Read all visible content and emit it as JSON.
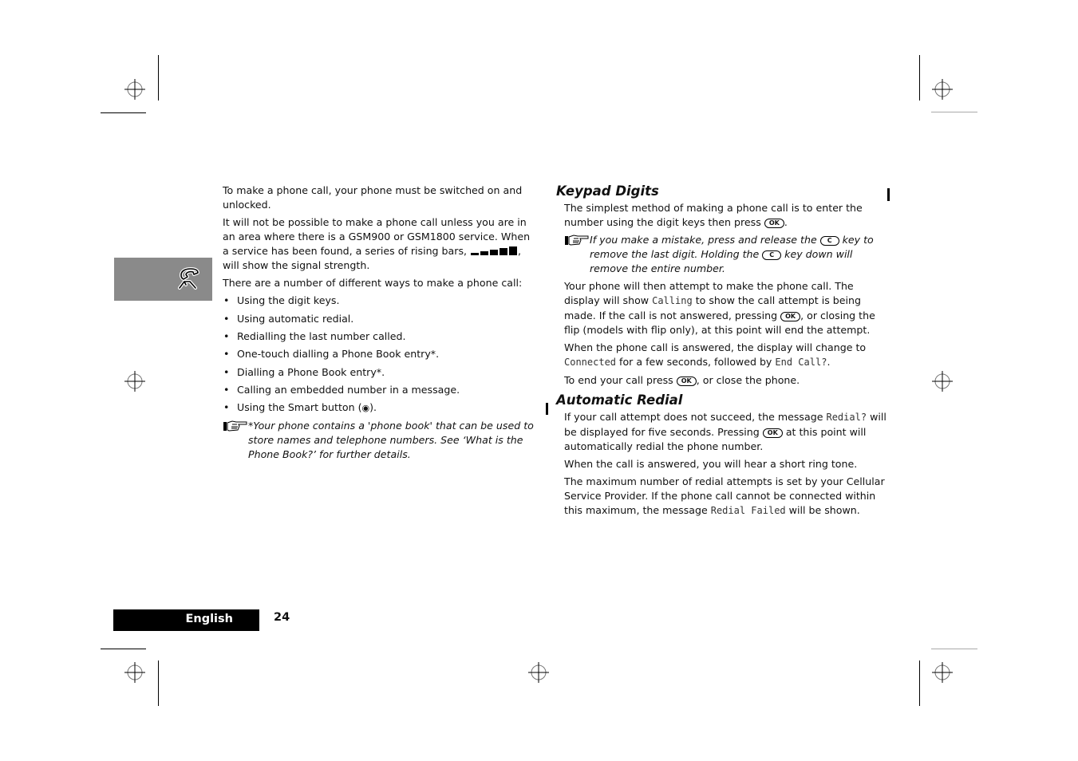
{
  "left_column": {
    "paragraphs": [
      "To make a phone call, your phone must be switched on and unlocked.",
      "It will not be possible to make a phone call unless you are in an area where there is a GSM900 or GSM1800 service. When a service has been found, a series of rising bars,",
      ", will show the signal strength.",
      "There are a number of different ways to make a phone call:"
    ],
    "bullets": [
      "Using the digit keys.",
      "Using automatic redial.",
      "Redialling the last number called.",
      "One-touch dialling a Phone Book entry*.",
      "Dialling a Phone Book entry*.",
      "Calling an embedded number in a message.",
      "Using the Smart button ("
    ],
    "bullet_tail": ").",
    "bullet_char": "•",
    "smart_icon": "◉",
    "note": "*Your phone contains a 'phone book' that can be used to store names and telephone numbers. See ‘What is the Phone Book?’ for further details."
  },
  "right_column": {
    "keypad": {
      "heading": "Keypad Digits",
      "p1a": "The simplest method of making a phone call is to enter the number using the digit keys then press",
      "p1b": ".",
      "note_a": "If you make a mistake, press and release the",
      "note_b": "key to remove the last digit. Holding the",
      "note_c": "key down will remove the entire number.",
      "p2a": "Your phone will then attempt to make the phone call. The display will show",
      "p2_mono": "Calling",
      "p2b": "to show the call attempt is being made. If the call is not answered, pressing",
      "p2c": ", or closing the flip (models with flip only), at this point will end the attempt.",
      "p3a": "When the phone call is answered, the display will change to",
      "p3_mono1": "Connected",
      "p3b": "for a few seconds, followed by",
      "p3_mono2": "End Call?",
      "p3c": ".",
      "p4a": "To end your call press",
      "p4b": ", or close the phone."
    },
    "redial": {
      "heading": "Automatic Redial",
      "p1a": "If your call attempt does not succeed, the message",
      "p1_mono": "Redial?",
      "p1b": "will be displayed for five seconds. Pressing",
      "p1c": "at this point will automatically redial the phone number.",
      "p2": "When the call is answered, you will hear a short ring tone.",
      "p3a": "The maximum number of redial attempts is set by your Cellular Service Provider. If the phone call cannot be connected within this maximum, the message",
      "p3_mono": "Redial Failed",
      "p3b": "will be shown."
    }
  },
  "keys": {
    "ok": "OK",
    "c": "C"
  },
  "footer": {
    "language": "English",
    "page_number": "24"
  },
  "section_tab": {
    "icon": "phone-handset-icon",
    "color": "#8a8a8a"
  }
}
